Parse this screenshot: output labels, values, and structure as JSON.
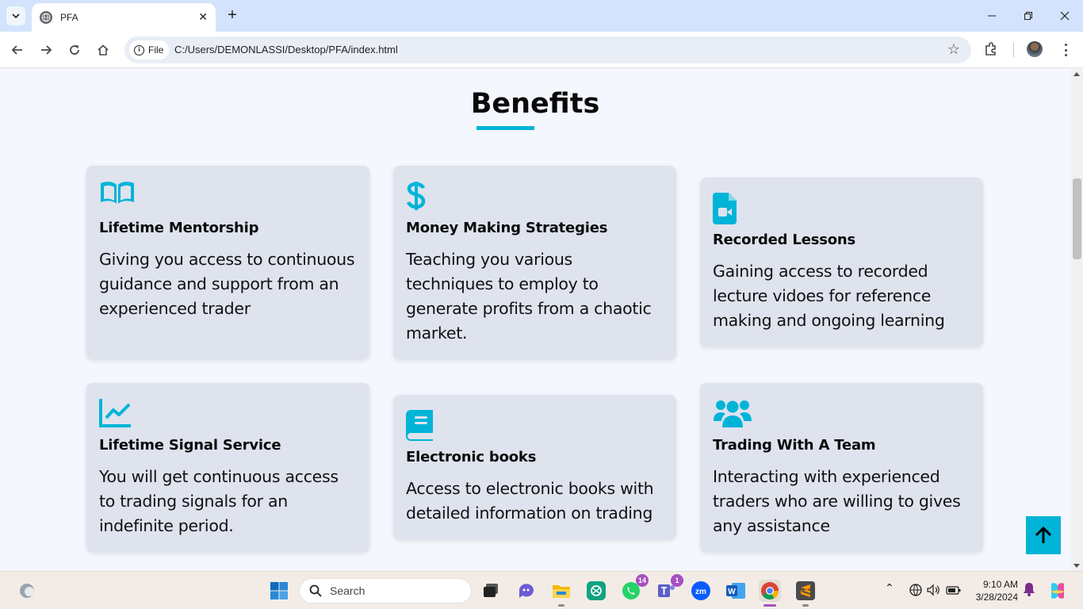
{
  "browser": {
    "tab_title": "PFA",
    "url_chip": "File",
    "url": "C:/Users/DEMONLASSI/Desktop/PFA/index.html"
  },
  "page": {
    "section_title": "Benefits",
    "accent_color": "#00b4d8",
    "cards": [
      {
        "icon": "book-open-icon",
        "title": "Lifetime Mentorship",
        "text": "Giving you access to continuous guidance and support from an experienced trader"
      },
      {
        "icon": "dollar-icon",
        "title": "Money Making Strategies",
        "text": "Teaching you various techniques to employ to generate profits from a chaotic market."
      },
      {
        "icon": "video-file-icon",
        "title": "Recorded Lessons",
        "text": "Gaining access to recorded lecture vidoes for reference making and ongoing learning"
      },
      {
        "icon": "chart-line-icon",
        "title": "Lifetime Signal Service",
        "text": "You will get continuous access to trading signals for an indefinite period."
      },
      {
        "icon": "book-icon",
        "title": "Electronic books",
        "text": "Access to electronic books with detailed information on trading"
      },
      {
        "icon": "users-icon",
        "title": "Trading With A Team",
        "text": "Interacting with experienced traders who are willing to gives any assistance"
      }
    ]
  },
  "taskbar": {
    "search_label": "Search",
    "whatsapp_badge": "14",
    "teams_badge": "1",
    "time": "9:10 AM",
    "date": "3/28/2024"
  }
}
